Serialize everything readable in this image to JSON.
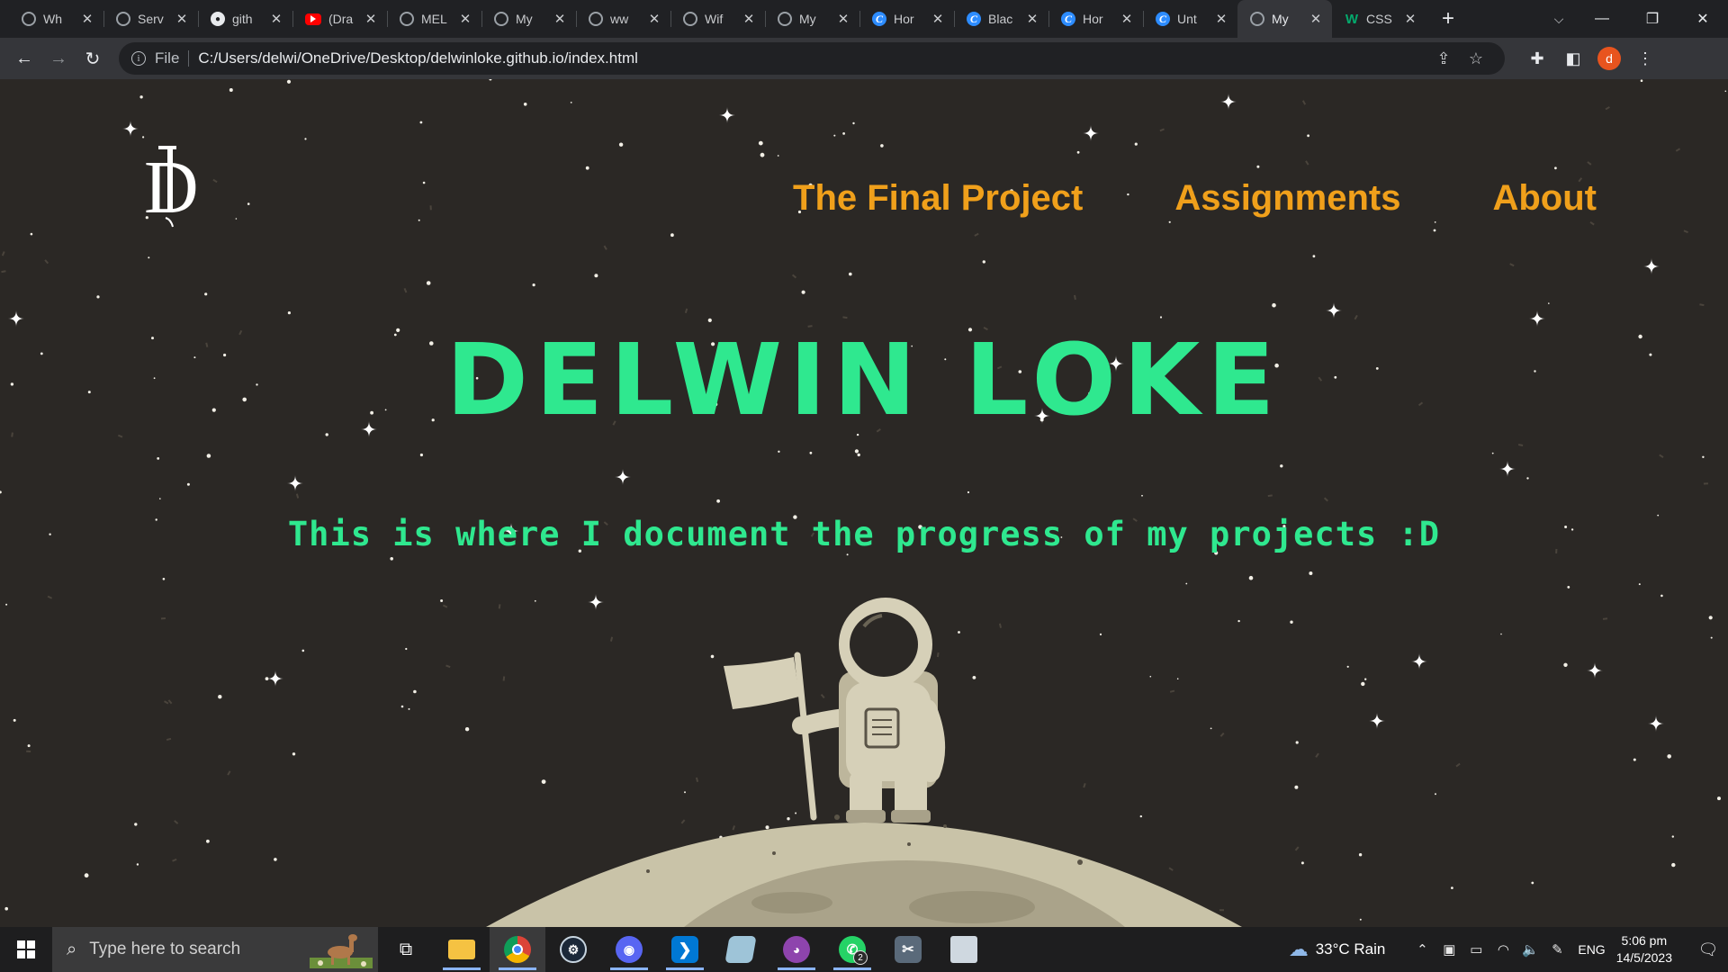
{
  "browser": {
    "tabs": [
      {
        "label": "Wh",
        "favicon": "chrome-icon",
        "active": false
      },
      {
        "label": "Serv",
        "favicon": "globe-icon",
        "active": false
      },
      {
        "label": "gith",
        "favicon": "github-icon",
        "active": false
      },
      {
        "label": "(Dra",
        "favicon": "youtube-icon",
        "active": false
      },
      {
        "label": "MEL",
        "favicon": "globe-icon",
        "active": false
      },
      {
        "label": "My",
        "favicon": "globe-icon",
        "active": false
      },
      {
        "label": "ww",
        "favicon": "globe-icon",
        "active": false
      },
      {
        "label": "Wif",
        "favicon": "globe-icon",
        "active": false
      },
      {
        "label": "My",
        "favicon": "globe-icon",
        "active": false
      },
      {
        "label": "Hor",
        "favicon": "canva-icon",
        "active": false
      },
      {
        "label": "Blac",
        "favicon": "canva-icon",
        "active": false
      },
      {
        "label": "Hor",
        "favicon": "canva-icon",
        "active": false
      },
      {
        "label": "Unt",
        "favicon": "canva-icon",
        "active": false
      },
      {
        "label": "My",
        "favicon": "globe-icon",
        "active": true
      },
      {
        "label": "CSS",
        "favicon": "w3schools-icon",
        "active": false
      }
    ],
    "close_glyph": "✕",
    "new_tab_glyph": "+",
    "address": {
      "scheme_label": "File",
      "url": "C:/Users/delwi/OneDrive/Desktop/delwinloke.github.io/index.html"
    },
    "profile_initial": "d"
  },
  "page": {
    "logo_text": "D",
    "nav": [
      {
        "label": "The Final Project"
      },
      {
        "label": "Assignments"
      },
      {
        "label": "About"
      }
    ],
    "title": "DELWIN LOKE",
    "subtitle": "This is where I document the progress of my projects :D",
    "colors": {
      "background": "#2b2825",
      "nav_link": "#f0a01b",
      "hero_text": "#2fe88f",
      "moon": "#c9c3a8",
      "astronaut": "#d6d0b8"
    }
  },
  "taskbar": {
    "search_placeholder": "Type here to search",
    "apps": [
      {
        "name": "task-view",
        "running": false
      },
      {
        "name": "file-explorer",
        "running": true
      },
      {
        "name": "chrome",
        "running": true,
        "active": true
      },
      {
        "name": "steam",
        "running": false
      },
      {
        "name": "discord",
        "running": true
      },
      {
        "name": "vscode",
        "running": true
      },
      {
        "name": "notes",
        "running": false
      },
      {
        "name": "github-desktop",
        "running": true
      },
      {
        "name": "whatsapp",
        "running": true,
        "badge": "2"
      },
      {
        "name": "snip-tool",
        "running": false
      },
      {
        "name": "photos",
        "running": false
      }
    ],
    "weather": "33°C  Rain",
    "language": "ENG",
    "time": "5:06 pm",
    "date": "14/5/2023"
  }
}
